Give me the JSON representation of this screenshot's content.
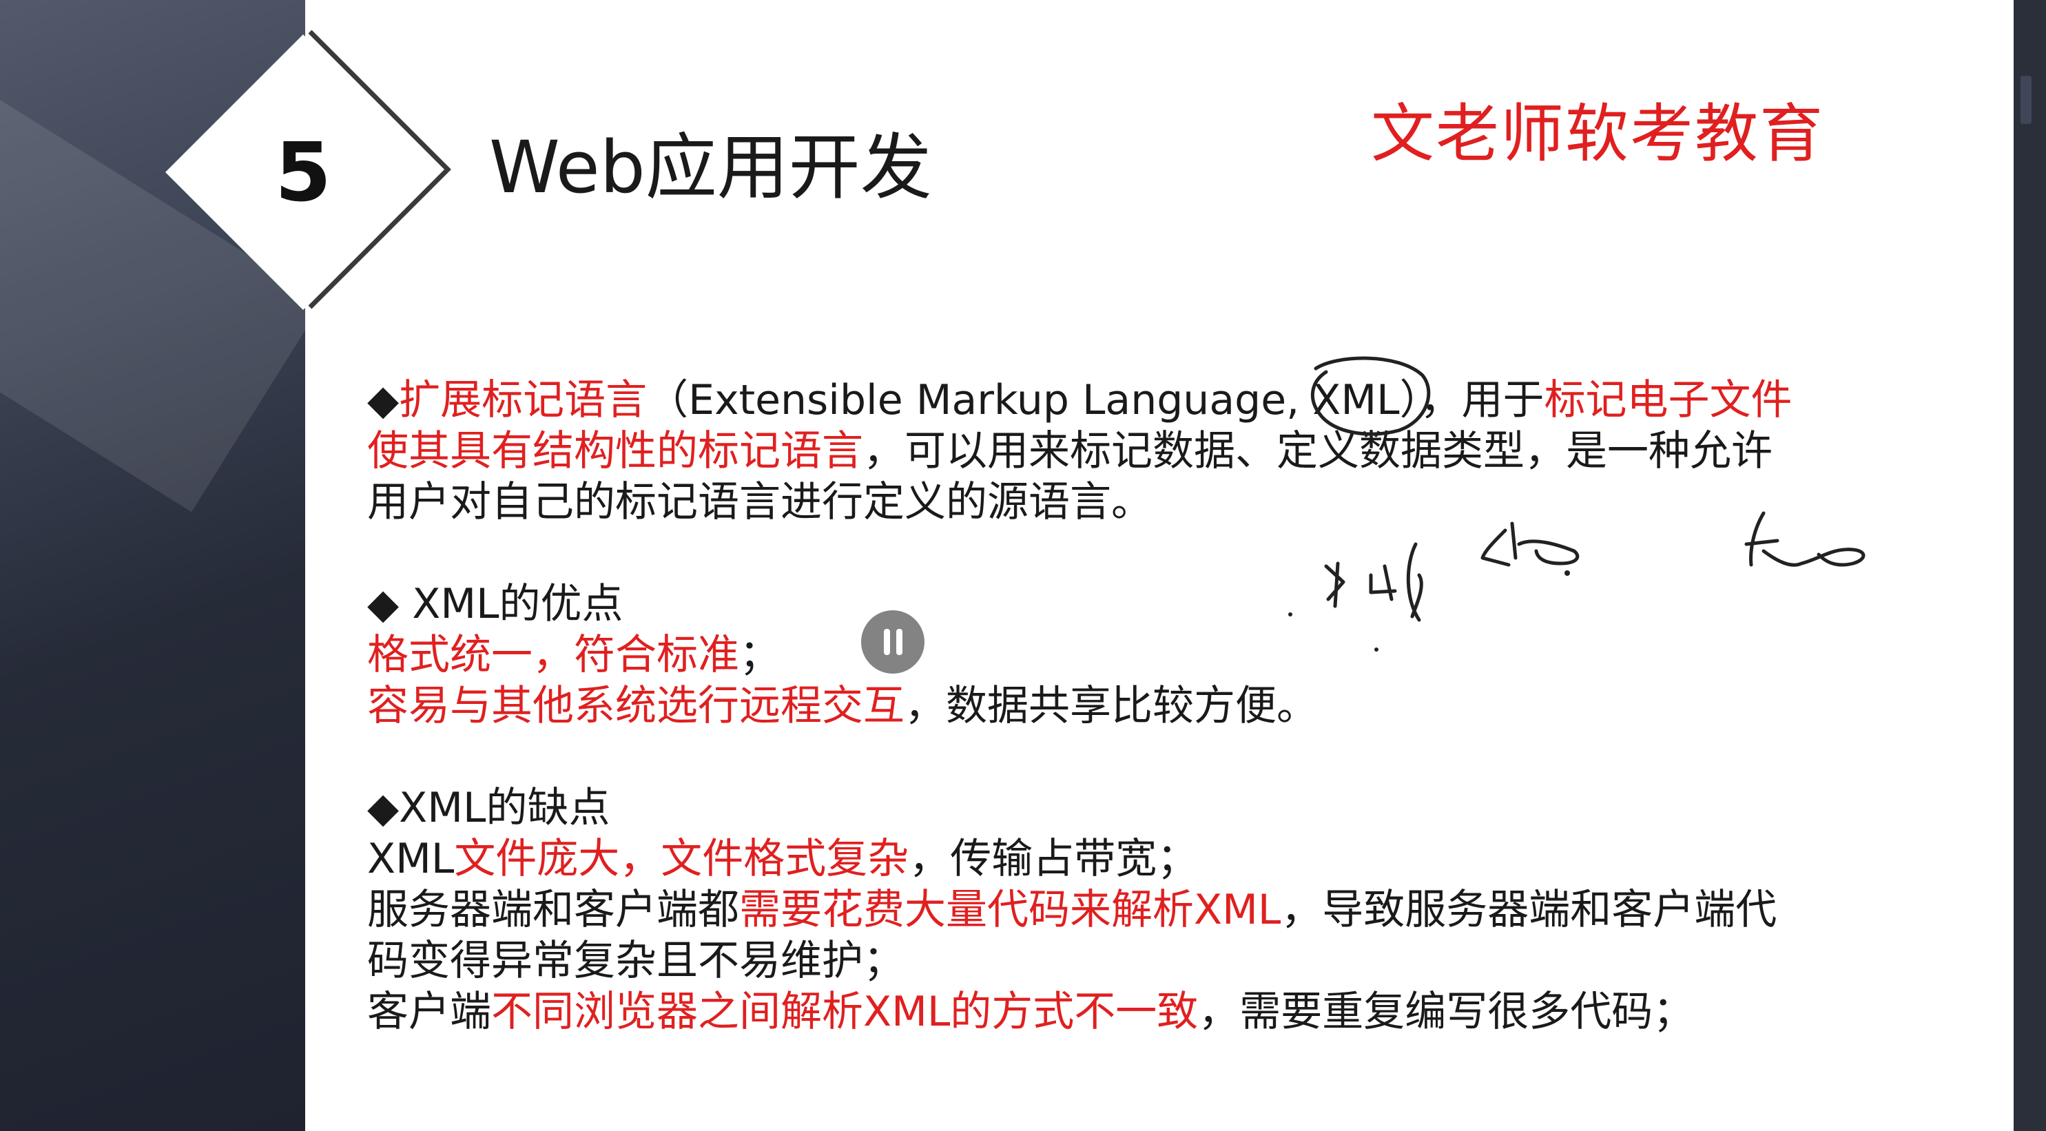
{
  "slide": {
    "number": "5",
    "title": "Web应用开发",
    "brand": "文老师软考教育",
    "paragraphs": [
      {
        "id": "intro",
        "lines": [
          [
            {
              "t": "◆"
            },
            {
              "t": "扩展标记语言",
              "red": true
            },
            {
              "t": "（Extensible Markup Language, XML），用于"
            },
            {
              "t": "标记电子文件",
              "red": true
            }
          ],
          [
            {
              "t": "使其具有结构性的标记语言",
              "red": true
            },
            {
              "t": "，可以用来标记数据、定义数据类型，是一种允许"
            }
          ],
          [
            {
              "t": "用户对自己的标记语言进行定义的源语言。"
            }
          ]
        ]
      },
      {
        "id": "advantages",
        "lines": [
          [
            {
              "t": "◆ XML的优点"
            }
          ],
          [
            {
              "t": "格式统一，符合标准",
              "red": true
            },
            {
              "t": "；"
            }
          ],
          [
            {
              "t": "容易与其他系统选行远程交互",
              "red": true
            },
            {
              "t": "，数据共享比较方便。"
            }
          ]
        ]
      },
      {
        "id": "disadvantages",
        "lines": [
          [
            {
              "t": "◆XML的缺点"
            }
          ],
          [
            {
              "t": "XML"
            },
            {
              "t": "文件庞大，文件格式复杂",
              "red": true
            },
            {
              "t": "，传输占带宽；"
            }
          ],
          [
            {
              "t": "服务器端和客户端都"
            },
            {
              "t": "需要花费大量代码来解析XML",
              "red": true
            },
            {
              "t": "，导致服务器端和客户端代"
            }
          ],
          [
            {
              "t": "码变得异常复杂且不易维护；"
            }
          ],
          [
            {
              "t": "客户端"
            },
            {
              "t": "不同浏览器之间解析XML的方式不一致",
              "red": true
            },
            {
              "t": "，需要重复编写很多代码；"
            }
          ]
        ]
      }
    ]
  },
  "colors": {
    "accent_red": "#e02020",
    "text": "#1a1a1a",
    "sidebar": "#2a2e3b"
  },
  "player": {
    "pause_icon": "pause-icon"
  }
}
